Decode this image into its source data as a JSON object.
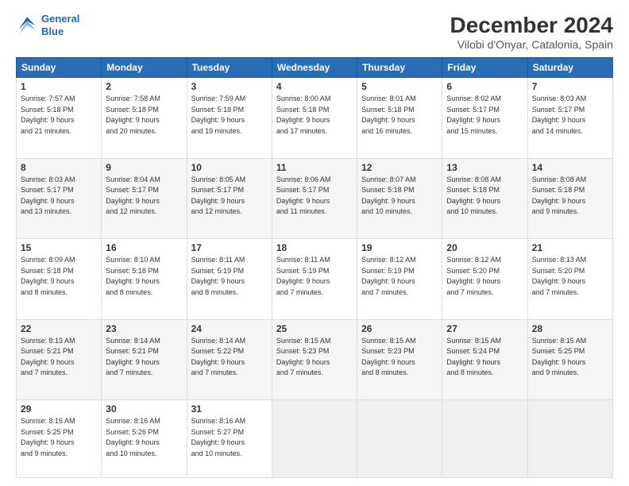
{
  "header": {
    "logo_line1": "General",
    "logo_line2": "Blue",
    "title": "December 2024",
    "subtitle": "Vilobi d'Onyar, Catalonia, Spain"
  },
  "days_of_week": [
    "Sunday",
    "Monday",
    "Tuesday",
    "Wednesday",
    "Thursday",
    "Friday",
    "Saturday"
  ],
  "weeks": [
    [
      {
        "day": "1",
        "info": "Sunrise: 7:57 AM\nSunset: 5:18 PM\nDaylight: 9 hours\nand 21 minutes."
      },
      {
        "day": "2",
        "info": "Sunrise: 7:58 AM\nSunset: 5:18 PM\nDaylight: 9 hours\nand 20 minutes."
      },
      {
        "day": "3",
        "info": "Sunrise: 7:59 AM\nSunset: 5:18 PM\nDaylight: 9 hours\nand 19 minutes."
      },
      {
        "day": "4",
        "info": "Sunrise: 8:00 AM\nSunset: 5:18 PM\nDaylight: 9 hours\nand 17 minutes."
      },
      {
        "day": "5",
        "info": "Sunrise: 8:01 AM\nSunset: 5:18 PM\nDaylight: 9 hours\nand 16 minutes."
      },
      {
        "day": "6",
        "info": "Sunrise: 8:02 AM\nSunset: 5:17 PM\nDaylight: 9 hours\nand 15 minutes."
      },
      {
        "day": "7",
        "info": "Sunrise: 8:03 AM\nSunset: 5:17 PM\nDaylight: 9 hours\nand 14 minutes."
      }
    ],
    [
      {
        "day": "8",
        "info": "Sunrise: 8:03 AM\nSunset: 5:17 PM\nDaylight: 9 hours\nand 13 minutes."
      },
      {
        "day": "9",
        "info": "Sunrise: 8:04 AM\nSunset: 5:17 PM\nDaylight: 9 hours\nand 12 minutes."
      },
      {
        "day": "10",
        "info": "Sunrise: 8:05 AM\nSunset: 5:17 PM\nDaylight: 9 hours\nand 12 minutes."
      },
      {
        "day": "11",
        "info": "Sunrise: 8:06 AM\nSunset: 5:17 PM\nDaylight: 9 hours\nand 11 minutes."
      },
      {
        "day": "12",
        "info": "Sunrise: 8:07 AM\nSunset: 5:18 PM\nDaylight: 9 hours\nand 10 minutes."
      },
      {
        "day": "13",
        "info": "Sunrise: 8:08 AM\nSunset: 5:18 PM\nDaylight: 9 hours\nand 10 minutes."
      },
      {
        "day": "14",
        "info": "Sunrise: 8:08 AM\nSunset: 5:18 PM\nDaylight: 9 hours\nand 9 minutes."
      }
    ],
    [
      {
        "day": "15",
        "info": "Sunrise: 8:09 AM\nSunset: 5:18 PM\nDaylight: 9 hours\nand 8 minutes."
      },
      {
        "day": "16",
        "info": "Sunrise: 8:10 AM\nSunset: 5:18 PM\nDaylight: 9 hours\nand 8 minutes."
      },
      {
        "day": "17",
        "info": "Sunrise: 8:11 AM\nSunset: 5:19 PM\nDaylight: 9 hours\nand 8 minutes."
      },
      {
        "day": "18",
        "info": "Sunrise: 8:11 AM\nSunset: 5:19 PM\nDaylight: 9 hours\nand 7 minutes."
      },
      {
        "day": "19",
        "info": "Sunrise: 8:12 AM\nSunset: 5:19 PM\nDaylight: 9 hours\nand 7 minutes."
      },
      {
        "day": "20",
        "info": "Sunrise: 8:12 AM\nSunset: 5:20 PM\nDaylight: 9 hours\nand 7 minutes."
      },
      {
        "day": "21",
        "info": "Sunrise: 8:13 AM\nSunset: 5:20 PM\nDaylight: 9 hours\nand 7 minutes."
      }
    ],
    [
      {
        "day": "22",
        "info": "Sunrise: 8:13 AM\nSunset: 5:21 PM\nDaylight: 9 hours\nand 7 minutes."
      },
      {
        "day": "23",
        "info": "Sunrise: 8:14 AM\nSunset: 5:21 PM\nDaylight: 9 hours\nand 7 minutes."
      },
      {
        "day": "24",
        "info": "Sunrise: 8:14 AM\nSunset: 5:22 PM\nDaylight: 9 hours\nand 7 minutes."
      },
      {
        "day": "25",
        "info": "Sunrise: 8:15 AM\nSunset: 5:23 PM\nDaylight: 9 hours\nand 7 minutes."
      },
      {
        "day": "26",
        "info": "Sunrise: 8:15 AM\nSunset: 5:23 PM\nDaylight: 9 hours\nand 8 minutes."
      },
      {
        "day": "27",
        "info": "Sunrise: 8:15 AM\nSunset: 5:24 PM\nDaylight: 9 hours\nand 8 minutes."
      },
      {
        "day": "28",
        "info": "Sunrise: 8:15 AM\nSunset: 5:25 PM\nDaylight: 9 hours\nand 9 minutes."
      }
    ],
    [
      {
        "day": "29",
        "info": "Sunrise: 8:16 AM\nSunset: 5:25 PM\nDaylight: 9 hours\nand 9 minutes."
      },
      {
        "day": "30",
        "info": "Sunrise: 8:16 AM\nSunset: 5:26 PM\nDaylight: 9 hours\nand 10 minutes."
      },
      {
        "day": "31",
        "info": "Sunrise: 8:16 AM\nSunset: 5:27 PM\nDaylight: 9 hours\nand 10 minutes."
      },
      null,
      null,
      null,
      null
    ]
  ]
}
